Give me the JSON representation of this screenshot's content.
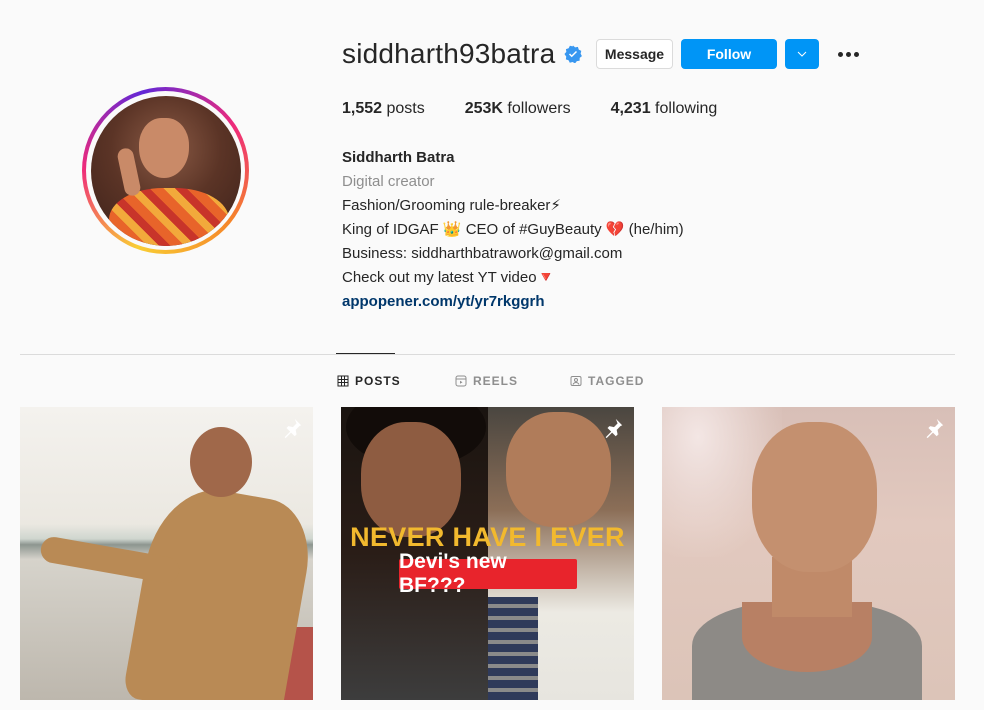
{
  "profile": {
    "username": "siddharth93batra",
    "verified": true,
    "buttons": {
      "message": "Message",
      "follow": "Follow"
    },
    "stats": {
      "posts_count": "1,552",
      "posts_label": " posts",
      "followers_count": "253K",
      "followers_label": " followers",
      "following_count": "4,231",
      "following_label": " following"
    },
    "bio": {
      "name": "Siddharth Batra",
      "category": "Digital creator",
      "lines": [
        "Fashion/Grooming rule-breaker⚡",
        "King of IDGAF 👑 CEO of #GuyBeauty 💔 (he/him)",
        "Business: siddharthbatrawork@gmail.com",
        "Check out my latest YT video🔻"
      ],
      "link": "appopener.com/yt/yr7rkggrh"
    }
  },
  "tabs": [
    {
      "label": "POSTS",
      "icon": "grid-icon",
      "active": true
    },
    {
      "label": "REELS",
      "icon": "reels-icon",
      "active": false
    },
    {
      "label": "TAGGED",
      "icon": "tagged-icon",
      "active": false
    }
  ],
  "posts": [
    {
      "pinned": true
    },
    {
      "pinned": true,
      "headline": "NEVER HAVE I EVER",
      "subhead": "Devi's new BF???"
    },
    {
      "pinned": true
    }
  ],
  "colors": {
    "accent": "#0095f6",
    "link": "#00376b",
    "muted": "#8e8e8e",
    "headline_yellow": "#f2b92e",
    "label_red": "#e8242c"
  }
}
